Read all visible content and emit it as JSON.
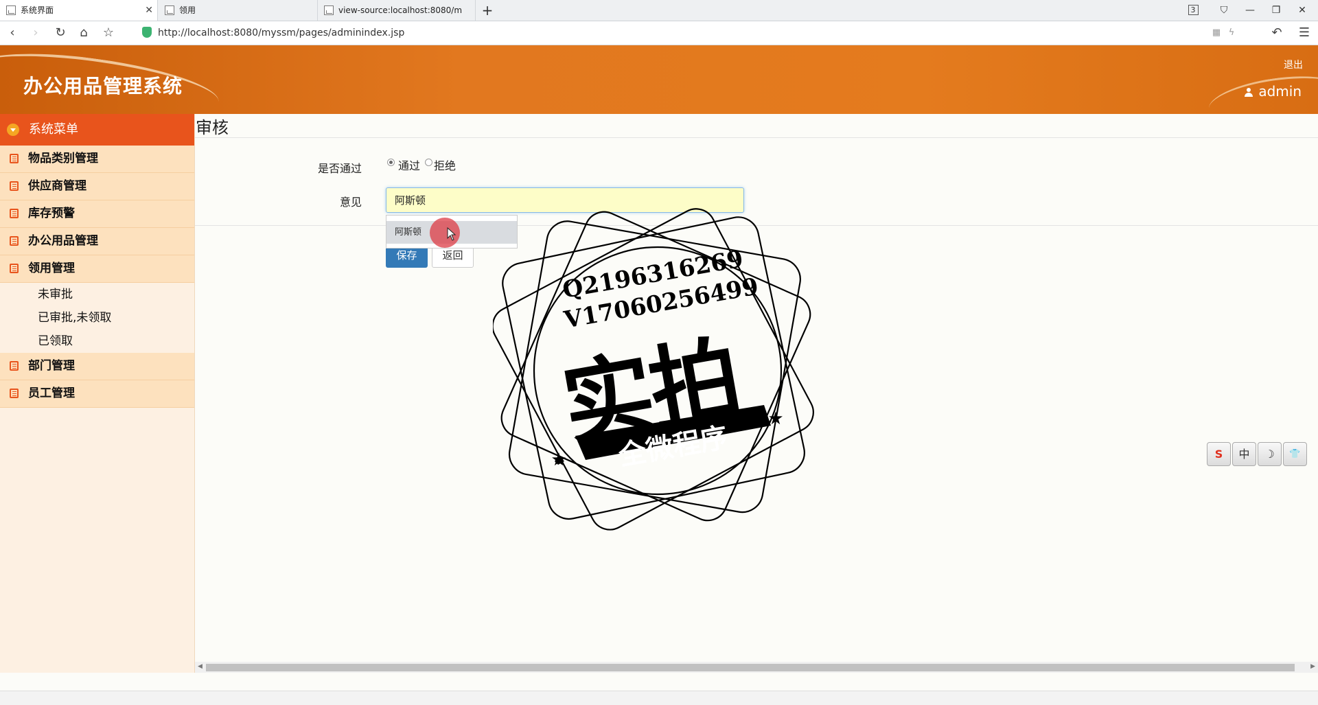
{
  "browser": {
    "tabs": [
      {
        "label": "系统界面",
        "active": true
      },
      {
        "label": "领用",
        "active": false
      },
      {
        "label": "view-source:localhost:8080/m",
        "active": false
      }
    ],
    "new_tab": "+",
    "tab_count": "3",
    "url": "http://localhost:8080/myssm/pages/adminindex.jsp"
  },
  "header": {
    "title": "办公用品管理系统",
    "logout": "退出",
    "user": "admin"
  },
  "sidebar": {
    "menu_title": "系统菜单",
    "groups": [
      {
        "label": "物品类别管理"
      },
      {
        "label": "供应商管理"
      },
      {
        "label": "库存预警"
      },
      {
        "label": "办公用品管理"
      },
      {
        "label": "领用管理",
        "sub": [
          "未审批",
          "已审批,未领取",
          "已领取"
        ]
      },
      {
        "label": "部门管理"
      },
      {
        "label": "员工管理"
      }
    ]
  },
  "form": {
    "page_title": "审核",
    "pass_label": "是否通过",
    "options": [
      "通过",
      "拒绝"
    ],
    "selected_option": "通过",
    "opinion_label": "意见",
    "opinion_value": "阿斯顿",
    "autocomplete": [
      "阿斯顿"
    ],
    "save": "保存",
    "back": "返回"
  },
  "ime": {
    "keys": [
      "S",
      "中",
      "☽",
      "👕"
    ]
  },
  "watermark": {
    "line1": "Q2196316269",
    "line2": "V17060256499",
    "main": "实拍",
    "banner": "全微程序"
  }
}
